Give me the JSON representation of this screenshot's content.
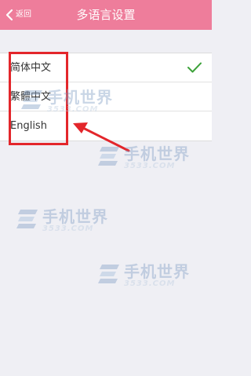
{
  "header": {
    "back_label": "返回",
    "title": "多语言设置",
    "background": "#ee7d9b"
  },
  "languages": [
    {
      "label": "简体中文",
      "selected": true
    },
    {
      "label": "繁體中文",
      "selected": false
    },
    {
      "label": "English",
      "selected": false
    }
  ],
  "icons": {
    "back": "chevron-left-icon",
    "selected": "checkmark-icon"
  },
  "colors": {
    "check": "#3da23a",
    "annotation": "#e3262b"
  },
  "watermark": {
    "brand": "手机世界",
    "site": "3533.COM"
  }
}
